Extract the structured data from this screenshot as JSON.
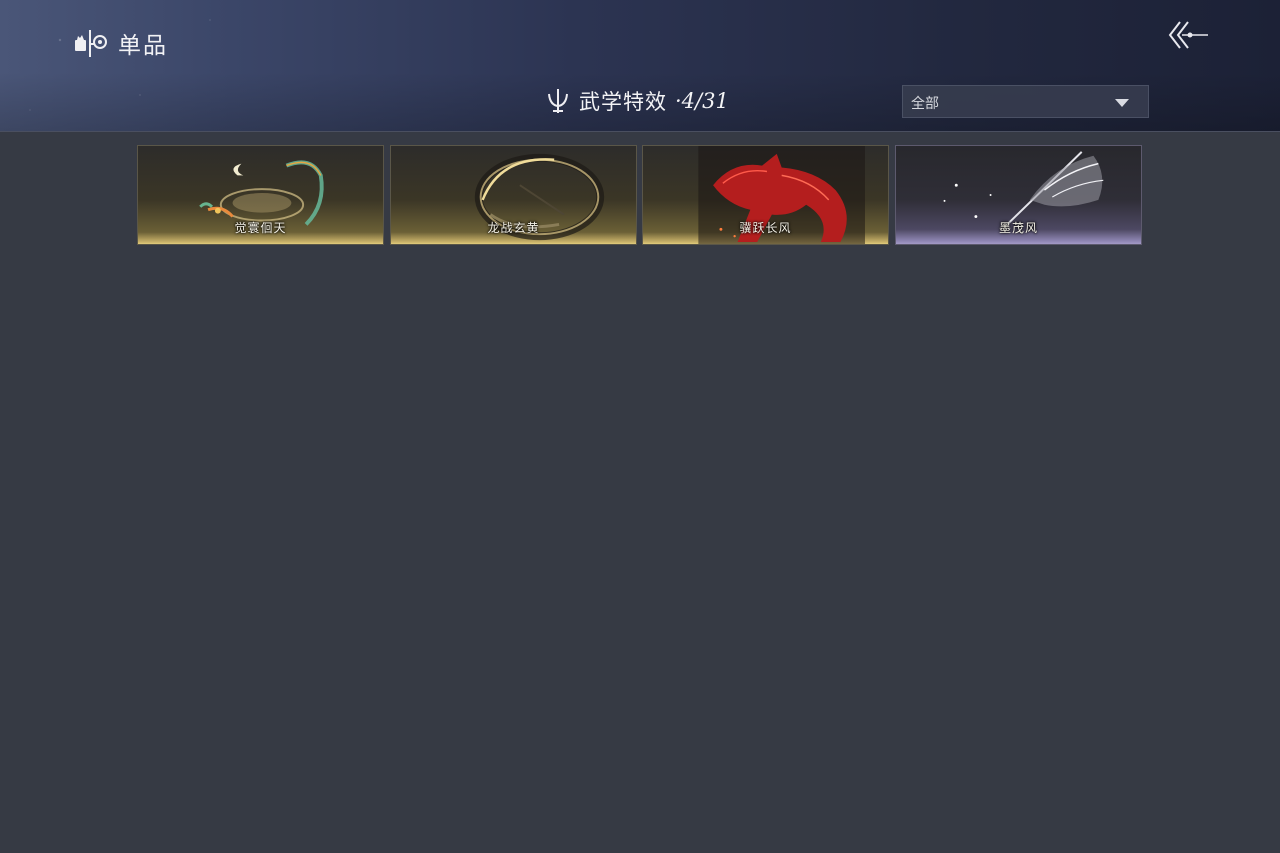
{
  "header": {
    "section_title": "单品",
    "section_icon": "shop-item-icon",
    "back_icon": "back-arrow-icon"
  },
  "category": {
    "icon": "martial-trident-icon",
    "label": "武学特效",
    "count": "·4/31"
  },
  "filter": {
    "selected": "全部"
  },
  "items": [
    {
      "name": "觉寰佪天",
      "rarity": "gold"
    },
    {
      "name": "龙战玄黄",
      "rarity": "gold"
    },
    {
      "name": "骥跃长风",
      "rarity": "gold"
    },
    {
      "name": "墨茂风",
      "rarity": "purple"
    }
  ],
  "colors": {
    "background": "#363a44",
    "gold_accent": "#e2cc7c",
    "purple_accent": "#a39ac6"
  }
}
